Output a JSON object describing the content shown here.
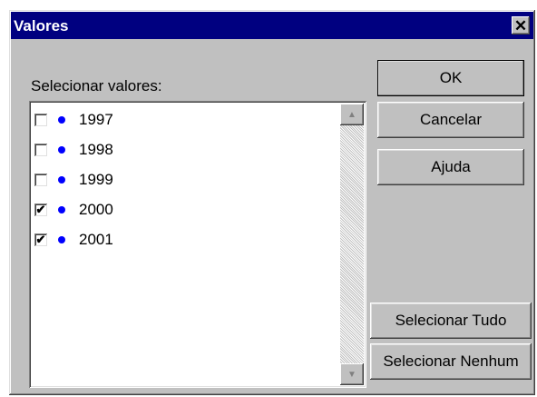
{
  "window": {
    "title": "Valores",
    "close_symbol": "✕"
  },
  "list": {
    "label": "Selecionar valores:",
    "items": [
      {
        "label": "1997",
        "checked": false
      },
      {
        "label": "1998",
        "checked": false
      },
      {
        "label": "1999",
        "checked": false
      },
      {
        "label": "2000",
        "checked": true
      },
      {
        "label": "2001",
        "checked": true
      }
    ],
    "scroll_up_glyph": "▲",
    "scroll_down_glyph": "▼"
  },
  "buttons": {
    "ok": "OK",
    "cancel": "Cancelar",
    "help": "Ajuda",
    "select_all": "Selecionar Tudo",
    "select_none": "Selecionar Nenhum"
  },
  "colors": {
    "titlebar": "#000080",
    "bullet": "#0000ff",
    "face": "#c0c0c0"
  }
}
